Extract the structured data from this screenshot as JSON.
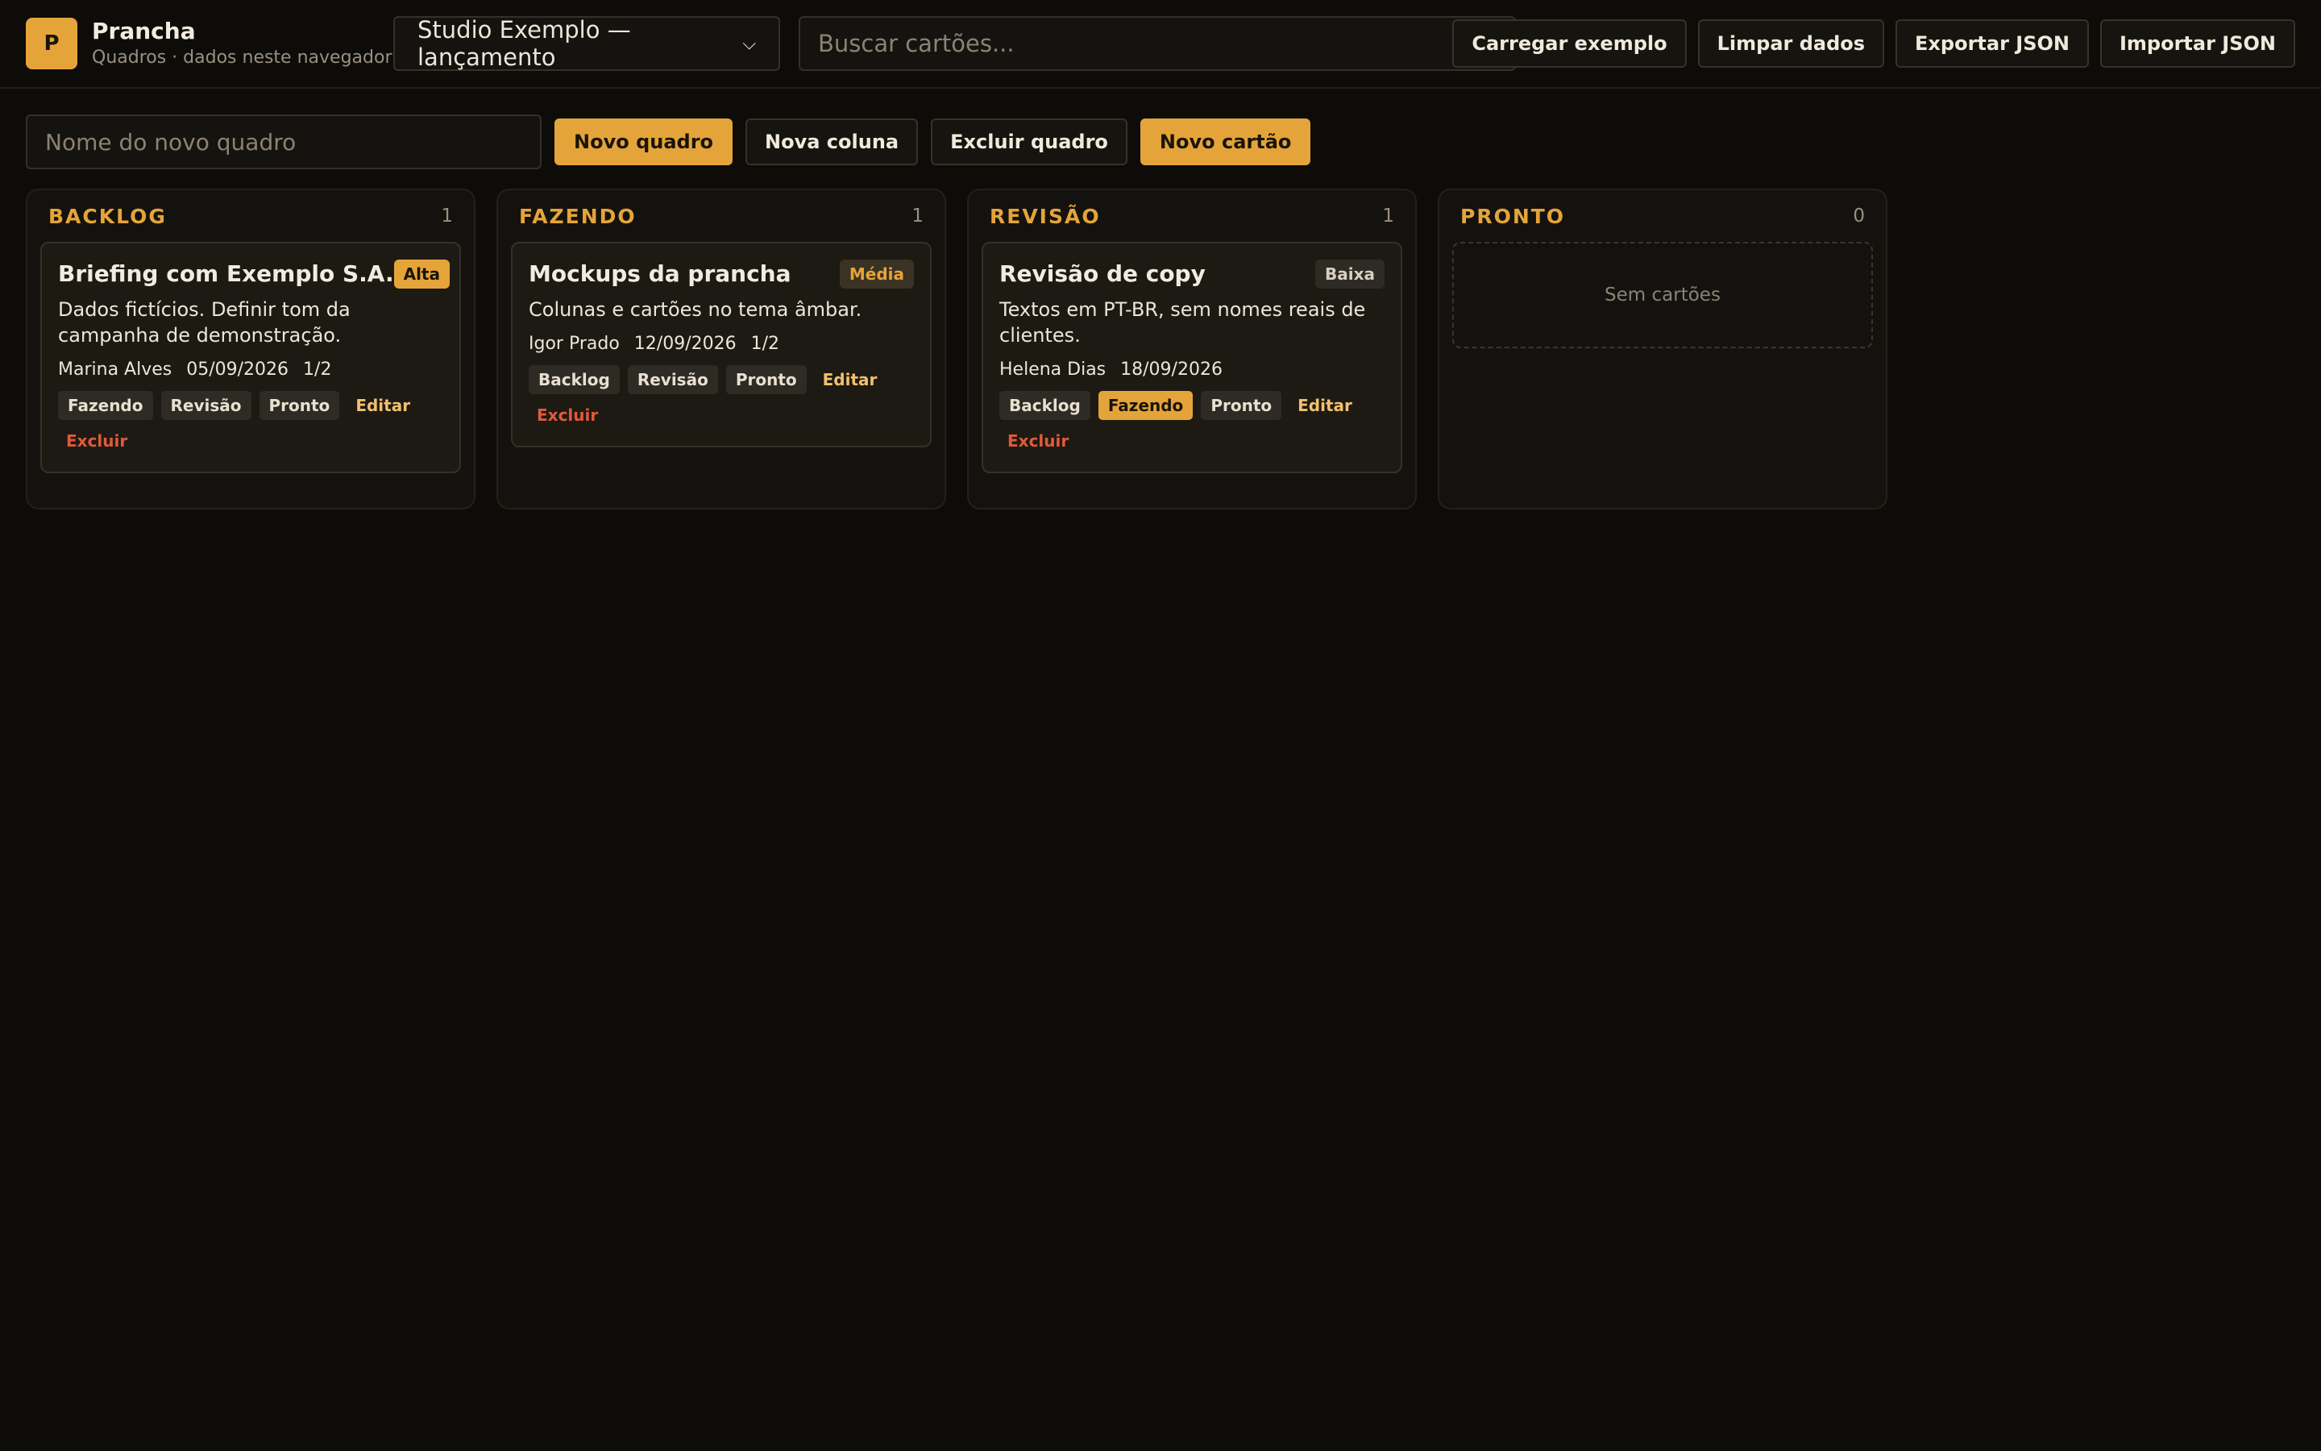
{
  "app": {
    "logo_letter": "P",
    "name": "Prancha",
    "subtitle": "Quadros · dados neste navegador"
  },
  "board_select": {
    "selected": "Studio Exemplo — lançamento"
  },
  "search": {
    "placeholder": "Buscar cartões..."
  },
  "top_actions": {
    "load_example": "Carregar exemplo",
    "clear_data": "Limpar dados",
    "export_json": "Exportar JSON",
    "import_json": "Importar JSON"
  },
  "toolbar": {
    "new_board_placeholder": "Nome do novo quadro",
    "new_board": "Novo quadro",
    "new_column": "Nova coluna",
    "delete_board": "Excluir quadro",
    "new_card": "Novo cartão"
  },
  "columns": [
    {
      "title": "BACKLOG",
      "count": "1",
      "cards": [
        {
          "title": "Briefing com Exemplo S.A.",
          "priority": "Alta",
          "description": "Dados fictícios. Definir tom da campanha de demonstração.",
          "assignee": "Marina Alves",
          "date": "05/09/2026",
          "checklist": "1/2",
          "moves": [
            "Fazendo",
            "Revisão",
            "Pronto"
          ],
          "edit": "Editar",
          "delete": "Excluir"
        }
      ]
    },
    {
      "title": "FAZENDO",
      "count": "1",
      "cards": [
        {
          "title": "Mockups da prancha",
          "priority": "Média",
          "description": "Colunas e cartões no tema âmbar.",
          "assignee": "Igor Prado",
          "date": "12/09/2026",
          "checklist": "1/2",
          "moves": [
            "Backlog",
            "Revisão",
            "Pronto"
          ],
          "edit": "Editar",
          "delete": "Excluir"
        }
      ]
    },
    {
      "title": "REVISÃO",
      "count": "1",
      "cards": [
        {
          "title": "Revisão de copy",
          "priority": "Baixa",
          "description": "Textos em PT-BR, sem nomes reais de clientes.",
          "assignee": "Helena Dias",
          "date": "18/09/2026",
          "checklist": "",
          "moves": [
            "Backlog",
            "Fazendo",
            "Pronto"
          ],
          "edit": "Editar",
          "delete": "Excluir"
        }
      ]
    },
    {
      "title": "PRONTO",
      "count": "0",
      "empty_text": "Sem cartões"
    }
  ],
  "colors": {
    "accent": "#e5a43a",
    "danger": "#e05a3a",
    "background": "#0d0c09"
  }
}
